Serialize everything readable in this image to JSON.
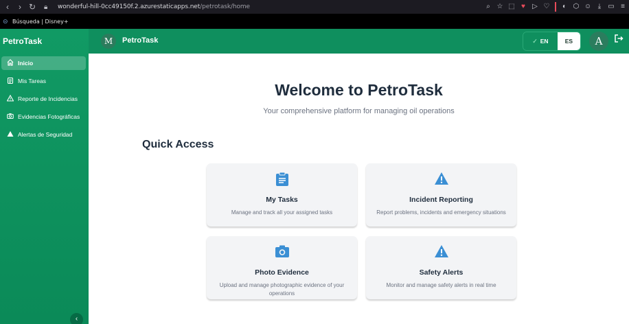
{
  "browser": {
    "url_host": "wonderful-hill-0cc49150f.2.azurestaticapps.net",
    "url_path": "/petrotask/home",
    "bookmarks": "Búsqueda | Disney+"
  },
  "sidebar": {
    "brand": "PetroTask",
    "items": [
      {
        "label": "Inicio",
        "icon": "home-icon"
      },
      {
        "label": "Mis Tareas",
        "icon": "clipboard-icon"
      },
      {
        "label": "Reporte de Incidencias",
        "icon": "warning-icon"
      },
      {
        "label": "Evidencias Fotográficas",
        "icon": "camera-icon"
      },
      {
        "label": "Alertas de Seguridad",
        "icon": "alert-triangle-icon"
      }
    ]
  },
  "header": {
    "logo_letter": "M",
    "title": "PetroTask",
    "lang_en": "EN",
    "lang_es": "ES",
    "user_initial": "A"
  },
  "main": {
    "welcome": "Welcome to PetroTask",
    "subtitle": "Your comprehensive platform for managing oil operations",
    "quick_access": "Quick Access",
    "cards": [
      {
        "title": "My Tasks",
        "desc": "Manage and track all your assigned tasks",
        "icon": "clipboard-icon"
      },
      {
        "title": "Incident Reporting",
        "desc": "Report problems, incidents and emergency situations",
        "icon": "warning-icon"
      },
      {
        "title": "Photo Evidence",
        "desc": "Upload and manage photographic evidence of your operations",
        "icon": "camera-icon"
      },
      {
        "title": "Safety Alerts",
        "desc": "Monitor and manage safety alerts in real time",
        "icon": "warning-icon"
      }
    ]
  },
  "colors": {
    "brand_green": "#0f8f5e",
    "card_icon_blue": "#3b8fd4",
    "heading_dark": "#1f2d3d"
  }
}
